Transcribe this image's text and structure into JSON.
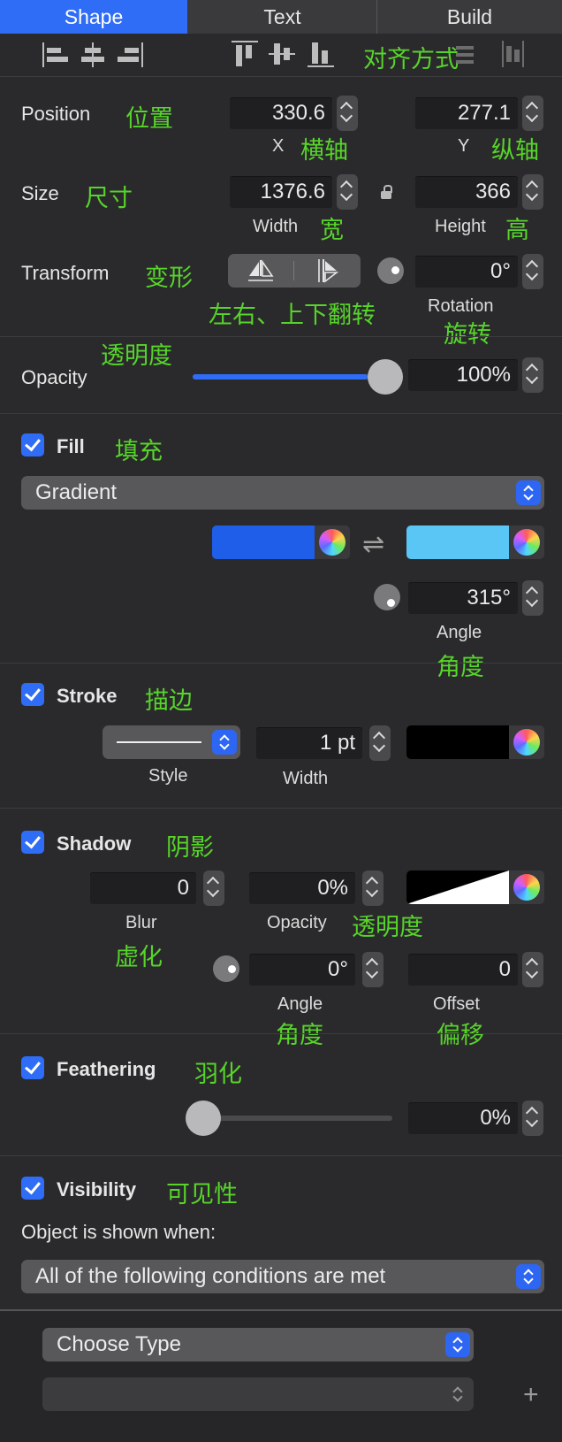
{
  "tabs": [
    {
      "label": "Shape",
      "active": true
    },
    {
      "label": "Text",
      "active": false
    },
    {
      "label": "Build",
      "active": false
    }
  ],
  "align_annotation": "对齐方式",
  "position": {
    "label": "Position",
    "annotation": "位置",
    "x": "330.6",
    "y": "277.1",
    "x_label": "X",
    "x_annotation": "横轴",
    "y_label": "Y",
    "y_annotation": "纵轴"
  },
  "size": {
    "label": "Size",
    "annotation": "尺寸",
    "width": "1376.6",
    "height": "366",
    "width_label": "Width",
    "width_annotation": "宽",
    "height_label": "Height",
    "height_annotation": "高"
  },
  "transform": {
    "label": "Transform",
    "annotation": "变形",
    "flip_annotation": "左右、上下翻转",
    "rotation": "0°",
    "rotation_label": "Rotation",
    "rotation_annotation": "旋转"
  },
  "opacity": {
    "annotation": "透明度",
    "label": "Opacity",
    "value": "100%",
    "slider_fraction": 1.0
  },
  "fill": {
    "label": "Fill",
    "annotation": "填充",
    "checked": true,
    "type": "Gradient",
    "color1": "#1f5ee8",
    "color2": "#5ac6f5",
    "angle": "315°",
    "angle_label": "Angle",
    "angle_annotation": "角度"
  },
  "stroke": {
    "label": "Stroke",
    "annotation": "描边",
    "checked": true,
    "style_label": "Style",
    "width": "1 pt",
    "width_label": "Width",
    "color": "#000000"
  },
  "shadow": {
    "label": "Shadow",
    "annotation": "阴影",
    "checked": true,
    "blur": "0",
    "blur_label": "Blur",
    "blur_annotation": "虚化",
    "opacity": "0%",
    "opacity_label": "Opacity",
    "opacity_annotation": "透明度",
    "angle": "0°",
    "angle_label": "Angle",
    "angle_annotation": "角度",
    "offset": "0",
    "offset_label": "Offset",
    "offset_annotation": "偏移"
  },
  "feathering": {
    "label": "Feathering",
    "annotation": "羽化",
    "checked": true,
    "value": "0%",
    "slider_fraction": 0.0
  },
  "visibility": {
    "label": "Visibility",
    "annotation": "可见性",
    "checked": true,
    "shown_when": "Object is shown when:",
    "condition": "All of the following conditions are met",
    "choose_type": "Choose Type",
    "add": "+"
  },
  "colors": {
    "background": "#2a2a2c",
    "accent": "#2f6df6",
    "annotation": "#57d42a"
  }
}
